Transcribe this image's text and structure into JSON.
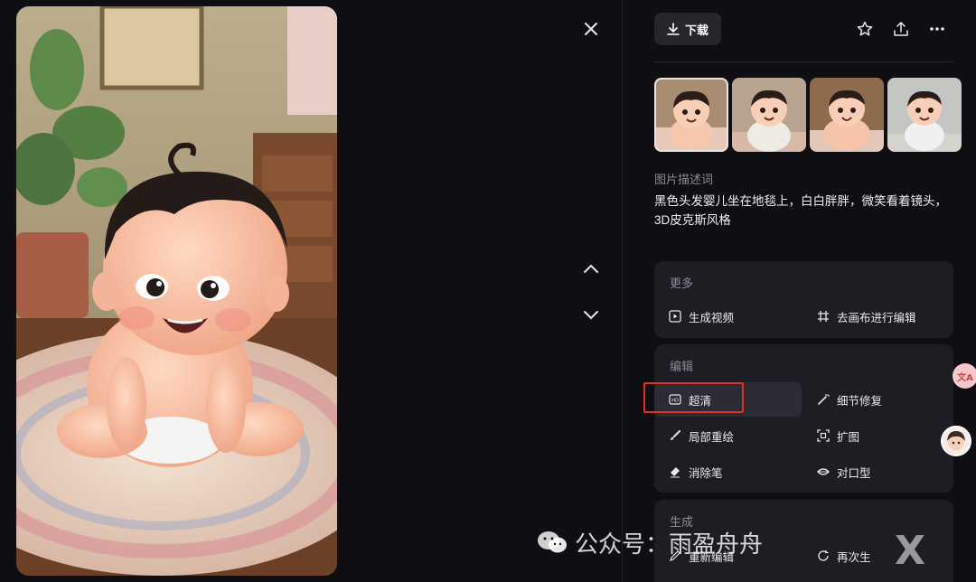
{
  "toolbar": {
    "download_label": "下载",
    "icons": [
      "download-icon",
      "star-icon",
      "share-icon",
      "more-icon"
    ]
  },
  "description": {
    "label": "图片描述词",
    "text": "黑色头发婴儿坐在地毯上，白白胖胖，微笑看着镜头，3D皮克斯风格"
  },
  "thumbnails": [
    {
      "name": "thumbnail-1",
      "selected": true
    },
    {
      "name": "thumbnail-2",
      "selected": false
    },
    {
      "name": "thumbnail-3",
      "selected": false
    },
    {
      "name": "thumbnail-4",
      "selected": false
    }
  ],
  "more_card": {
    "title": "更多",
    "items": [
      {
        "label": "生成视频",
        "icon": "play-icon"
      },
      {
        "label": "去画布进行编辑",
        "icon": "canvas-icon"
      }
    ]
  },
  "edit_card": {
    "title": "编辑",
    "items": [
      {
        "label": "超清",
        "icon": "hd-icon",
        "highlighted": true
      },
      {
        "label": "细节修复",
        "icon": "magic-wand-icon"
      },
      {
        "label": "局部重绘",
        "icon": "brush-icon"
      },
      {
        "label": "扩图",
        "icon": "expand-icon"
      },
      {
        "label": "消除笔",
        "icon": "eraser-icon"
      },
      {
        "label": "对口型",
        "icon": "lips-icon"
      }
    ]
  },
  "generate_card": {
    "title": "生成",
    "items": [
      {
        "label": "重新编辑",
        "icon": "edit-icon"
      },
      {
        "label": "再次生",
        "icon": "refresh-icon"
      }
    ]
  },
  "watermark": {
    "text": "公众号：雨盈舟舟",
    "corner_text": "X"
  },
  "colors": {
    "background": "#0f0f13",
    "card": "#1d1d23",
    "highlight": "#e0302b"
  }
}
